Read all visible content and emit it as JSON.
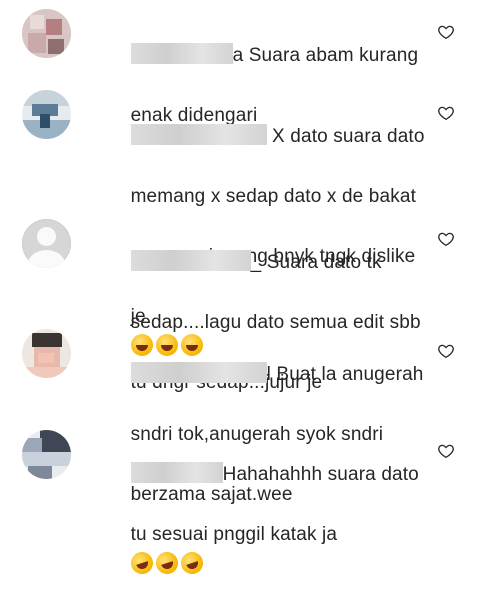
{
  "comments": [
    {
      "avatar": "user-photo",
      "lines": [
        "a Suara abam kurang",
        "enak didengari"
      ],
      "reactions": [],
      "like_icon": "heart-outline-icon"
    },
    {
      "avatar": "user-photo",
      "lines": [
        "X dato suara dato",
        "memang x sedap dato x de bakat",
        "menyanyi...orng bnyk tngk dislike",
        "je"
      ],
      "reactions": [
        "face-with-tears-of-joy",
        "face-with-tears-of-joy",
        "face-with-tears-of-joy"
      ],
      "like_icon": "heart-outline-icon"
    },
    {
      "avatar": "default-avatar",
      "lines": [
        "_ Suara dato tk",
        "sedap....lagu dato semua edit sbb",
        "tu dngr sedap...jujur je"
      ],
      "reactions": [],
      "like_icon": "heart-outline-icon"
    },
    {
      "avatar": "user-photo",
      "lines": [
        "l Buat la anugerah",
        "sndri tok,anugerah syok sndri",
        "berzama sajat.wee"
      ],
      "reactions": [],
      "like_icon": "heart-outline-icon"
    },
    {
      "avatar": "user-photo",
      "lines": [
        "Hahahahhh suara dato",
        "tu sesuai pnggil katak ja"
      ],
      "reactions": [
        "rolling-on-the-floor-laughing",
        "rolling-on-the-floor-laughing",
        "rolling-on-the-floor-laughing"
      ],
      "like_icon": "heart-outline-icon"
    }
  ],
  "colors": {
    "text": "#262626",
    "icon": "#262626",
    "redaction": "#d6d6d6"
  }
}
